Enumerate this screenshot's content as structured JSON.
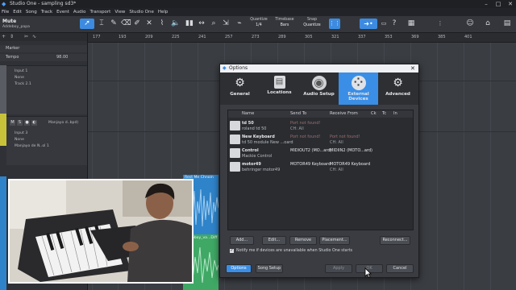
{
  "window": {
    "title": "Studio One - sampling sd3*",
    "minimize": "–",
    "maximize": "□",
    "close": "✕"
  },
  "menu": [
    "File",
    "Edit",
    "Song",
    "Track",
    "Event",
    "Audio",
    "Transport",
    "View",
    "Studio One",
    "Help"
  ],
  "toolbar": {
    "track_name": "Mute",
    "track_sub": "Addeboy_papa",
    "quantize_label": "Quantize",
    "quantize_value": "1/4",
    "timebase_label": "Timebase",
    "timebase_value": "Bars",
    "snap_label": "Snap",
    "snap_value": "Quantize"
  },
  "leftpanel": {
    "marker": "Marker",
    "tempo": "Tempo",
    "tempo_value": "98.00",
    "track1": {
      "input": "Input 1",
      "none": "None",
      "track": "Track 2.1"
    },
    "track2": {
      "m": "M",
      "s": "S",
      "name": "Manjayo d..bpd)",
      "input": "Input 3",
      "none": "None",
      "src": "Manjayo de N..ol 1"
    }
  },
  "ruler": [
    "177",
    "193",
    "209",
    "225",
    "241",
    "257",
    "273",
    "289",
    "305",
    "321",
    "337",
    "353",
    "369",
    "385",
    "401"
  ],
  "clips": {
    "clip1": "Rest Me Chnoin",
    "clip2": "Addeboy_va...Diff"
  },
  "dialog": {
    "title": "Options",
    "tabs": [
      "General",
      "Locations",
      "Audio Setup",
      "External Devices",
      "Advanced"
    ],
    "columns": [
      "Name",
      "Send To",
      "Receive From",
      "Ck",
      "Tc",
      "In"
    ],
    "devices": [
      {
        "name": "td 50",
        "sub": "roland td 50",
        "send": "Port not found!",
        "send_ch": "CH: All",
        "recv": "",
        "recv_ch": ""
      },
      {
        "name": "New Keyboard",
        "sub": "td 50 module New ...oard",
        "send": "Port not found!",
        "send_ch": "",
        "recv": "Port not found!",
        "recv_ch": "CH: All"
      },
      {
        "name": "Control",
        "sub": "Mackie Control",
        "send": "MIDIOUT2 (MO...ard)",
        "send_ch": "",
        "recv": "MIDIIN2 (MOTO...ard)",
        "recv_ch": ""
      },
      {
        "name": "motor49",
        "sub": "behringer motor49",
        "send": "MOTOR49 Keyboard",
        "send_ch": "",
        "recv": "MOTOR49 Keyboard",
        "recv_ch": "CH: All"
      }
    ],
    "buttons": {
      "add": "Add...",
      "edit": "Edit...",
      "remove": "Remove",
      "placement": "Placement...",
      "reconnect": "Reconnect..."
    },
    "notify": "Notify me if devices are unavailable when Studio One starts",
    "footer": {
      "options": "Options",
      "song_setup": "Song Setup",
      "apply": "Apply",
      "ok": "OK",
      "cancel": "Cancel"
    }
  },
  "colors": {
    "accent": "#3a8ee6",
    "clip_blue": "#2f83c9",
    "clip_green": "#3fa865",
    "track_yellow": "#c8c23a"
  }
}
